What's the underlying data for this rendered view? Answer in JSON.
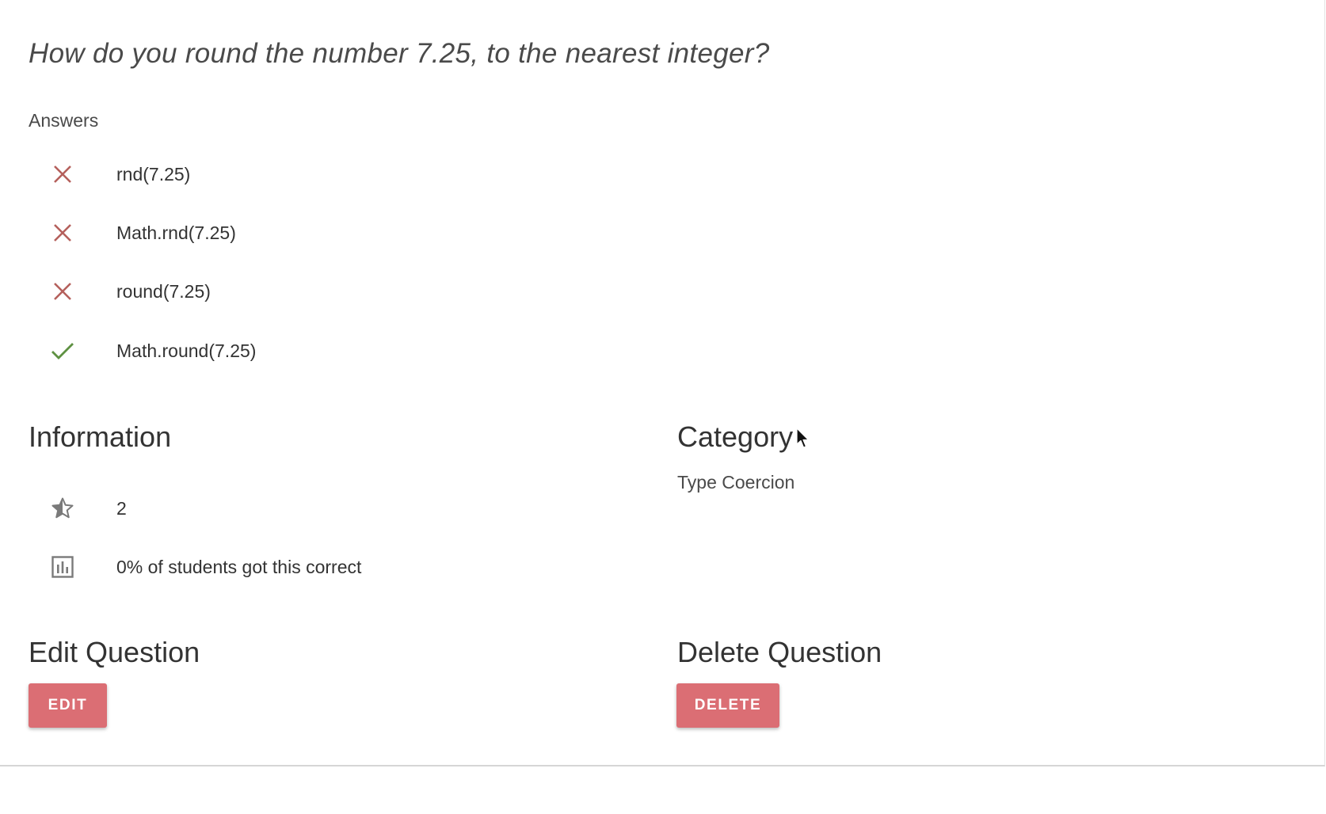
{
  "question": {
    "text": "How do you round the number 7.25, to the nearest integer?"
  },
  "answers": {
    "label": "Answers",
    "items": [
      {
        "text": "rnd(7.25)",
        "correct": false,
        "icon": "close-icon"
      },
      {
        "text": "Math.rnd(7.25)",
        "correct": false,
        "icon": "close-icon"
      },
      {
        "text": "round(7.25)",
        "correct": false,
        "icon": "close-icon"
      },
      {
        "text": "Math.round(7.25)",
        "correct": true,
        "icon": "check-icon"
      }
    ]
  },
  "information": {
    "title": "Information",
    "difficulty": {
      "icon": "star-half-icon",
      "value": "2"
    },
    "stats": {
      "icon": "bar-chart-icon",
      "text": "0% of students got this correct"
    }
  },
  "category": {
    "title": "Category",
    "value": "Type Coercion"
  },
  "edit": {
    "title": "Edit Question",
    "button_label": "EDIT"
  },
  "delete": {
    "title": "Delete Question",
    "button_label": "DELETE"
  },
  "colors": {
    "incorrect": "#b5605c",
    "correct": "#5e9142",
    "button": "#db6e74",
    "icon_gray": "#7a7a7a"
  }
}
